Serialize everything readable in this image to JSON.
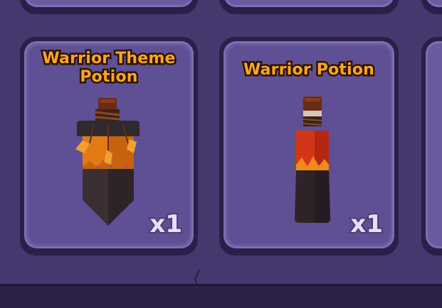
{
  "inventory": {
    "slots": [
      {
        "title": "Warrior Theme Potion",
        "title_line1": "Warrior Theme",
        "title_line2": "Potion",
        "quantity": "x1",
        "icon": "warrior-theme-potion-icon"
      },
      {
        "title": "Warrior Potion",
        "quantity": "x1",
        "icon": "warrior-potion-icon"
      }
    ]
  },
  "colors": {
    "title_text": "#ffa424",
    "title_outline": "#2a1400",
    "slot_face": "#6a5aa0",
    "background": "#47376f"
  }
}
